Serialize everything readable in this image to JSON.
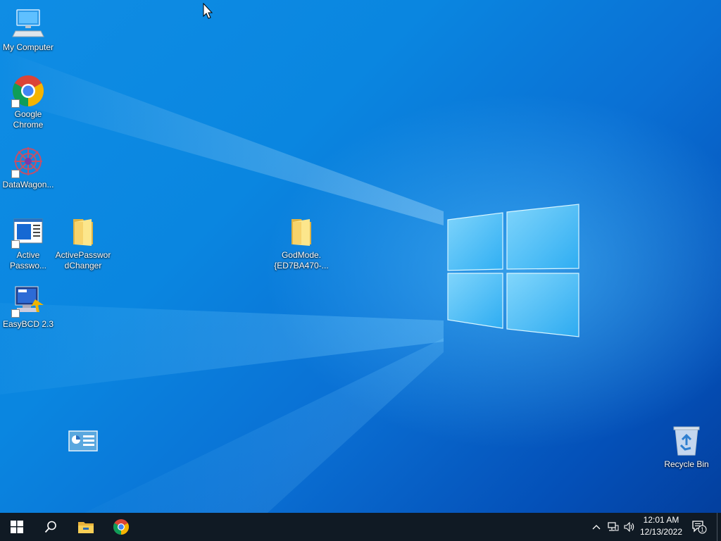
{
  "desktop": {
    "icons": [
      {
        "id": "my-computer",
        "label": "My Computer"
      },
      {
        "id": "google-chrome",
        "label": "Google Chrome"
      },
      {
        "id": "datawagon",
        "label": "DataWagon..."
      },
      {
        "id": "active-password",
        "label": "Active Passwo..."
      },
      {
        "id": "activepasswordchanger",
        "label": "ActivePasswordChanger"
      },
      {
        "id": "godmode",
        "label": "GodMode.{ED7BA470-..."
      },
      {
        "id": "easybcd",
        "label": "EasyBCD 2.3"
      },
      {
        "id": "control-panel",
        "label": ""
      },
      {
        "id": "recycle-bin",
        "label": "Recycle Bin"
      }
    ]
  },
  "taskbar": {
    "start": "start-icon",
    "search": "search-icon",
    "pinned": [
      "file-explorer-icon",
      "chrome-icon"
    ],
    "tray": {
      "time": "12:01 AM",
      "date": "12/13/2022",
      "notification_count": "1"
    }
  },
  "colors": {
    "taskbar_bg": "#101a24",
    "desktop_accent": "#0a7be0"
  }
}
